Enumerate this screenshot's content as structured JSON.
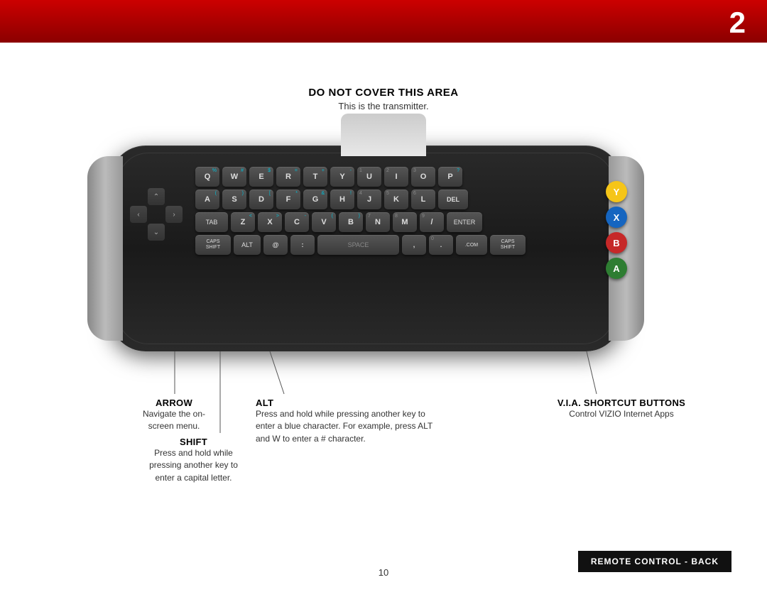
{
  "header": {
    "page_number": "2",
    "bg_color": "#cc0000"
  },
  "transmitter": {
    "title": "DO NOT COVER THIS AREA",
    "subtitle": "This is the transmitter."
  },
  "keyboard": {
    "row1": [
      {
        "main": "Q",
        "alt": "%"
      },
      {
        "main": "W",
        "alt": "#"
      },
      {
        "main": "E",
        "alt": "$"
      },
      {
        "main": "R",
        "alt": "="
      },
      {
        "main": "T",
        "alt": "+"
      },
      {
        "main": "Y",
        "alt": "-"
      },
      {
        "main": "U",
        "num": "1"
      },
      {
        "main": "I",
        "num": "2"
      },
      {
        "main": "O",
        "num": "3"
      },
      {
        "main": "P",
        "alt": "?"
      }
    ],
    "row2": [
      {
        "main": "A",
        "alt": "("
      },
      {
        "main": "S",
        "alt": ")"
      },
      {
        "main": "D",
        "alt": "["
      },
      {
        "main": "F",
        "alt": "*"
      },
      {
        "main": "G",
        "alt": "&"
      },
      {
        "main": "H",
        "alt": "!"
      },
      {
        "main": "J",
        "num": "4"
      },
      {
        "main": "K",
        "num": "5"
      },
      {
        "main": "L",
        "num": "6"
      },
      {
        "main": "DEL",
        "wide": true
      }
    ],
    "row3": [
      {
        "main": "TAB",
        "wide": true
      },
      {
        "main": "Z",
        "alt": "<"
      },
      {
        "main": "X",
        "alt": ">"
      },
      {
        "main": "C",
        "alt": "-"
      },
      {
        "main": "V",
        "alt": "("
      },
      {
        "main": "B",
        "alt": ")"
      },
      {
        "main": "N",
        "num": "7"
      },
      {
        "main": "M",
        "num": "8"
      },
      {
        "main": "/",
        "num": "9"
      },
      {
        "main": "ENTER",
        "wide": true
      }
    ],
    "row4": [
      {
        "main": "CAPS SHIFT",
        "wide2": true
      },
      {
        "main": "ALT",
        "wide": true
      },
      {
        "main": "@"
      },
      {
        "main": ":"
      },
      {
        "main": "SPACE",
        "space": true
      },
      {
        "main": ","
      },
      {
        "main": ".",
        "num": "0"
      },
      {
        "main": ".COM",
        "wide": true
      },
      {
        "main": "CAPS SHIFT",
        "wide2": true
      }
    ]
  },
  "via_buttons": [
    {
      "label": "Y",
      "color": "#f5c518"
    },
    {
      "label": "X",
      "color": "#1565c0"
    },
    {
      "label": "B",
      "color": "#c62828"
    },
    {
      "label": "A",
      "color": "#2e7d32"
    }
  ],
  "annotations": {
    "arrow": {
      "title": "ARROW",
      "text": "Navigate the on-screen menu."
    },
    "shift": {
      "title": "SHIFT",
      "text": "Press and hold while pressing another key to enter a capital letter."
    },
    "alt": {
      "title": "ALT",
      "text": "Press and hold while pressing another key to enter a blue character. For example, press ALT and W to enter a # character."
    },
    "via": {
      "title": "V.I.A. SHORTCUT BUTTONS",
      "text": "Control VIZIO Internet Apps"
    }
  },
  "footer": {
    "label": "REMOTE CONTROL - BACK",
    "page": "10"
  }
}
